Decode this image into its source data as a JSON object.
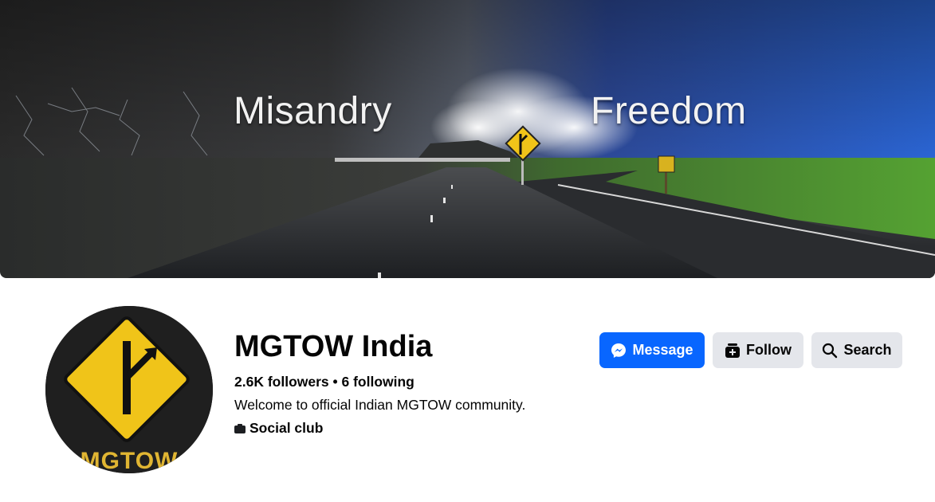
{
  "cover": {
    "left_word": "Misandry",
    "right_word": "Freedom"
  },
  "profile": {
    "name": "MGTOW India",
    "stats": "2.6K followers • 6 following",
    "bio": "Welcome to official Indian MGTOW community.",
    "category": "Social club",
    "avatar_text": "MGTOW"
  },
  "actions": {
    "message_label": "Message",
    "follow_label": "Follow",
    "search_label": "Search"
  },
  "colors": {
    "primary": "#0866ff",
    "secondary_button": "#e4e6eb",
    "sign_yellow": "#f0c419"
  },
  "icons": {
    "message": "messenger-icon",
    "follow": "follow-plus-icon",
    "search": "search-icon",
    "category": "briefcase-icon"
  }
}
